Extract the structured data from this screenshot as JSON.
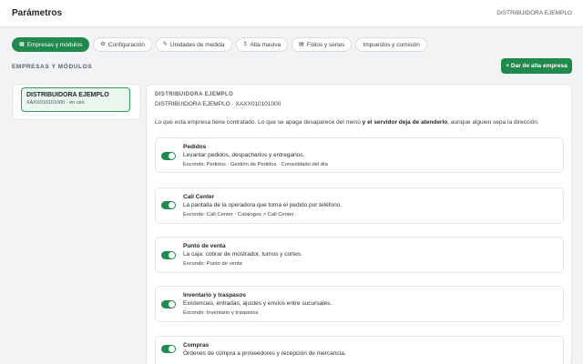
{
  "header": {
    "title": "Parámetros",
    "company": "DISTRIBUIDORA EJEMPLO"
  },
  "tabs": [
    {
      "label": "Empresas y módulos",
      "icon": "building-icon",
      "glyph": "▦",
      "active": true
    },
    {
      "label": "Configuración",
      "icon": "gear-icon",
      "glyph": "⚙"
    },
    {
      "label": "Unidades de medida",
      "icon": "ruler-icon",
      "glyph": "✎"
    },
    {
      "label": "Alta masiva",
      "icon": "upload-icon",
      "glyph": "↥"
    },
    {
      "label": "Folios y series",
      "icon": "folder-icon",
      "glyph": "▤"
    },
    {
      "label": "Impuestos y comisión",
      "icon": "",
      "glyph": ""
    }
  ],
  "section": {
    "title": "EMPRESAS Y MÓDULOS",
    "add_button": "+ Dar de alta empresa"
  },
  "company_list": [
    {
      "name": "DISTRIBUIDORA EJEMPLO",
      "sub": "XAXX010101000 · en uso",
      "selected": true
    }
  ],
  "main": {
    "kicker": "DISTRIBUIDORA EJEMPLO",
    "subtitle": "DISTRIBUIDORA EJEMPLO · XAXX010101000",
    "desc_part1": "Lo que esta empresa tiene contratado. Lo que se apaga desaparece del menú ",
    "desc_bold": "y el servidor deja de atenderlo",
    "desc_part2": ", aunque alguien sepa la dirección."
  },
  "modules": [
    {
      "name": "Pedidos",
      "desc": "Levantar pedidos, despacharlos y entregarlos.",
      "hides": "Esconde: Pedidos · Gestión de Pedidos · Consolidado del día",
      "enabled": true
    },
    {
      "name": "Call Center",
      "desc": "La pantalla de la operadora que toma el pedido por teléfono.",
      "hides": "Esconde: Call Center · Catalogos > Call Center",
      "enabled": true
    },
    {
      "name": "Punto de venta",
      "desc": "La caja: cobrar de mostrador, turnos y cortes.",
      "hides": "Esconde: Punto de venta",
      "enabled": true
    },
    {
      "name": "Inventario y traspasos",
      "desc": "Existencias, entradas, ajustes y envíos entre sucursales.",
      "hides": "Esconde: Inventario y traspasos",
      "enabled": true
    },
    {
      "name": "Compras",
      "desc": "Órdenes de compra a proveedores y recepción de mercancía.",
      "hides": "",
      "enabled": true
    }
  ],
  "colors": {
    "accent": "#1f8a4c",
    "selected_bg": "#eaf6ee",
    "page_bg": "#f1f3f5"
  }
}
